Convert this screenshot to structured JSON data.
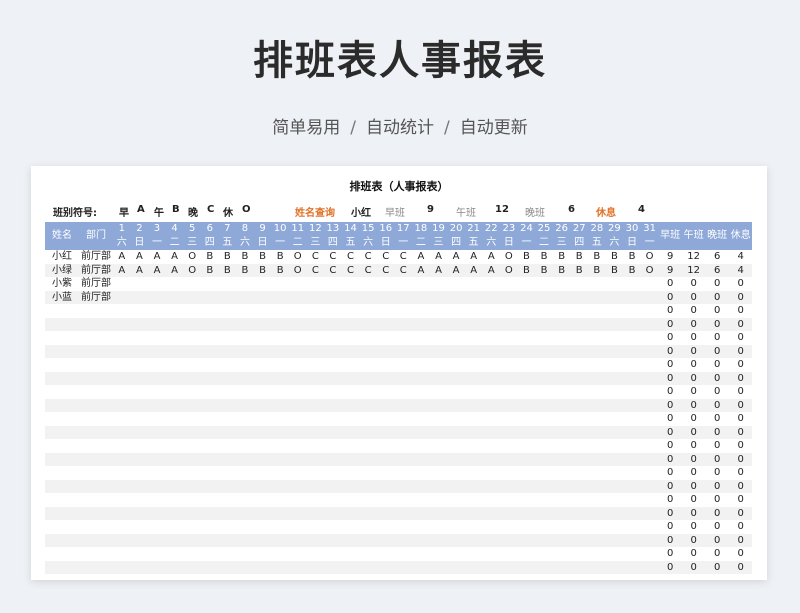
{
  "main_title": "排班表人事报表",
  "subtitle": [
    "简单易用",
    "自动统计",
    "自动更新"
  ],
  "subtitle_sep": "/",
  "sheet_title": "排班表（人事报表）",
  "legend": {
    "label": "班别符号:",
    "symbols": [
      "早",
      "A",
      "午",
      "B",
      "晚",
      "C",
      "休",
      "O"
    ]
  },
  "query": {
    "label": "姓名查询",
    "name": "小红",
    "early_label": "早班",
    "early_value": "9",
    "noon_label": "午班",
    "noon_value": "12",
    "night_label": "晚班",
    "night_value": "6",
    "rest_label": "休息",
    "rest_value": "4"
  },
  "header": {
    "name": "姓名",
    "dept": "部门",
    "days": [
      "1",
      "2",
      "3",
      "4",
      "5",
      "6",
      "7",
      "8",
      "9",
      "10",
      "11",
      "12",
      "13",
      "14",
      "15",
      "16",
      "17",
      "18",
      "19",
      "20",
      "21",
      "22",
      "23",
      "24",
      "25",
      "26",
      "27",
      "28",
      "29",
      "30",
      "31"
    ],
    "weekdays": [
      "六",
      "日",
      "一",
      "二",
      "三",
      "四",
      "五",
      "六",
      "日",
      "一",
      "二",
      "三",
      "四",
      "五",
      "六",
      "日",
      "一",
      "二",
      "三",
      "四",
      "五",
      "六",
      "日",
      "一",
      "二",
      "三",
      "四",
      "五",
      "六",
      "日",
      "一"
    ],
    "stats": [
      "早班",
      "午班",
      "晚班",
      "休息"
    ]
  },
  "rows": [
    {
      "name": "小红",
      "dept": "前厅部",
      "shifts": [
        "A",
        "A",
        "A",
        "A",
        "O",
        "B",
        "B",
        "B",
        "B",
        "B",
        "O",
        "C",
        "C",
        "C",
        "C",
        "C",
        "C",
        "A",
        "A",
        "A",
        "A",
        "A",
        "O",
        "B",
        "B",
        "B",
        "B",
        "B",
        "B",
        "B",
        "O"
      ],
      "stats": [
        "9",
        "12",
        "6",
        "4"
      ]
    },
    {
      "name": "小绿",
      "dept": "前厅部",
      "shifts": [
        "A",
        "A",
        "A",
        "A",
        "O",
        "B",
        "B",
        "B",
        "B",
        "B",
        "O",
        "C",
        "C",
        "C",
        "C",
        "C",
        "C",
        "A",
        "A",
        "A",
        "A",
        "A",
        "O",
        "B",
        "B",
        "B",
        "B",
        "B",
        "B",
        "B",
        "O"
      ],
      "stats": [
        "9",
        "12",
        "6",
        "4"
      ]
    },
    {
      "name": "小紫",
      "dept": "前厅部",
      "shifts": [],
      "stats": [
        "0",
        "0",
        "0",
        "0"
      ]
    },
    {
      "name": "小蓝",
      "dept": "前厅部",
      "shifts": [],
      "stats": [
        "0",
        "0",
        "0",
        "0"
      ]
    },
    {
      "name": "",
      "dept": "",
      "shifts": [],
      "stats": [
        "0",
        "0",
        "0",
        "0"
      ]
    },
    {
      "name": "",
      "dept": "",
      "shifts": [],
      "stats": [
        "0",
        "0",
        "0",
        "0"
      ]
    },
    {
      "name": "",
      "dept": "",
      "shifts": [],
      "stats": [
        "0",
        "0",
        "0",
        "0"
      ]
    },
    {
      "name": "",
      "dept": "",
      "shifts": [],
      "stats": [
        "0",
        "0",
        "0",
        "0"
      ]
    },
    {
      "name": "",
      "dept": "",
      "shifts": [],
      "stats": [
        "0",
        "0",
        "0",
        "0"
      ]
    },
    {
      "name": "",
      "dept": "",
      "shifts": [],
      "stats": [
        "0",
        "0",
        "0",
        "0"
      ]
    },
    {
      "name": "",
      "dept": "",
      "shifts": [],
      "stats": [
        "0",
        "0",
        "0",
        "0"
      ]
    },
    {
      "name": "",
      "dept": "",
      "shifts": [],
      "stats": [
        "0",
        "0",
        "0",
        "0"
      ]
    },
    {
      "name": "",
      "dept": "",
      "shifts": [],
      "stats": [
        "0",
        "0",
        "0",
        "0"
      ]
    },
    {
      "name": "",
      "dept": "",
      "shifts": [],
      "stats": [
        "0",
        "0",
        "0",
        "0"
      ]
    },
    {
      "name": "",
      "dept": "",
      "shifts": [],
      "stats": [
        "0",
        "0",
        "0",
        "0"
      ]
    },
    {
      "name": "",
      "dept": "",
      "shifts": [],
      "stats": [
        "0",
        "0",
        "0",
        "0"
      ]
    },
    {
      "name": "",
      "dept": "",
      "shifts": [],
      "stats": [
        "0",
        "0",
        "0",
        "0"
      ]
    },
    {
      "name": "",
      "dept": "",
      "shifts": [],
      "stats": [
        "0",
        "0",
        "0",
        "0"
      ]
    },
    {
      "name": "",
      "dept": "",
      "shifts": [],
      "stats": [
        "0",
        "0",
        "0",
        "0"
      ]
    },
    {
      "name": "",
      "dept": "",
      "shifts": [],
      "stats": [
        "0",
        "0",
        "0",
        "0"
      ]
    },
    {
      "name": "",
      "dept": "",
      "shifts": [],
      "stats": [
        "0",
        "0",
        "0",
        "0"
      ]
    },
    {
      "name": "",
      "dept": "",
      "shifts": [],
      "stats": [
        "0",
        "0",
        "0",
        "0"
      ]
    },
    {
      "name": "",
      "dept": "",
      "shifts": [],
      "stats": [
        "0",
        "0",
        "0",
        "0"
      ]
    },
    {
      "name": "",
      "dept": "",
      "shifts": [],
      "stats": [
        "0",
        "0",
        "0",
        "0"
      ]
    }
  ]
}
